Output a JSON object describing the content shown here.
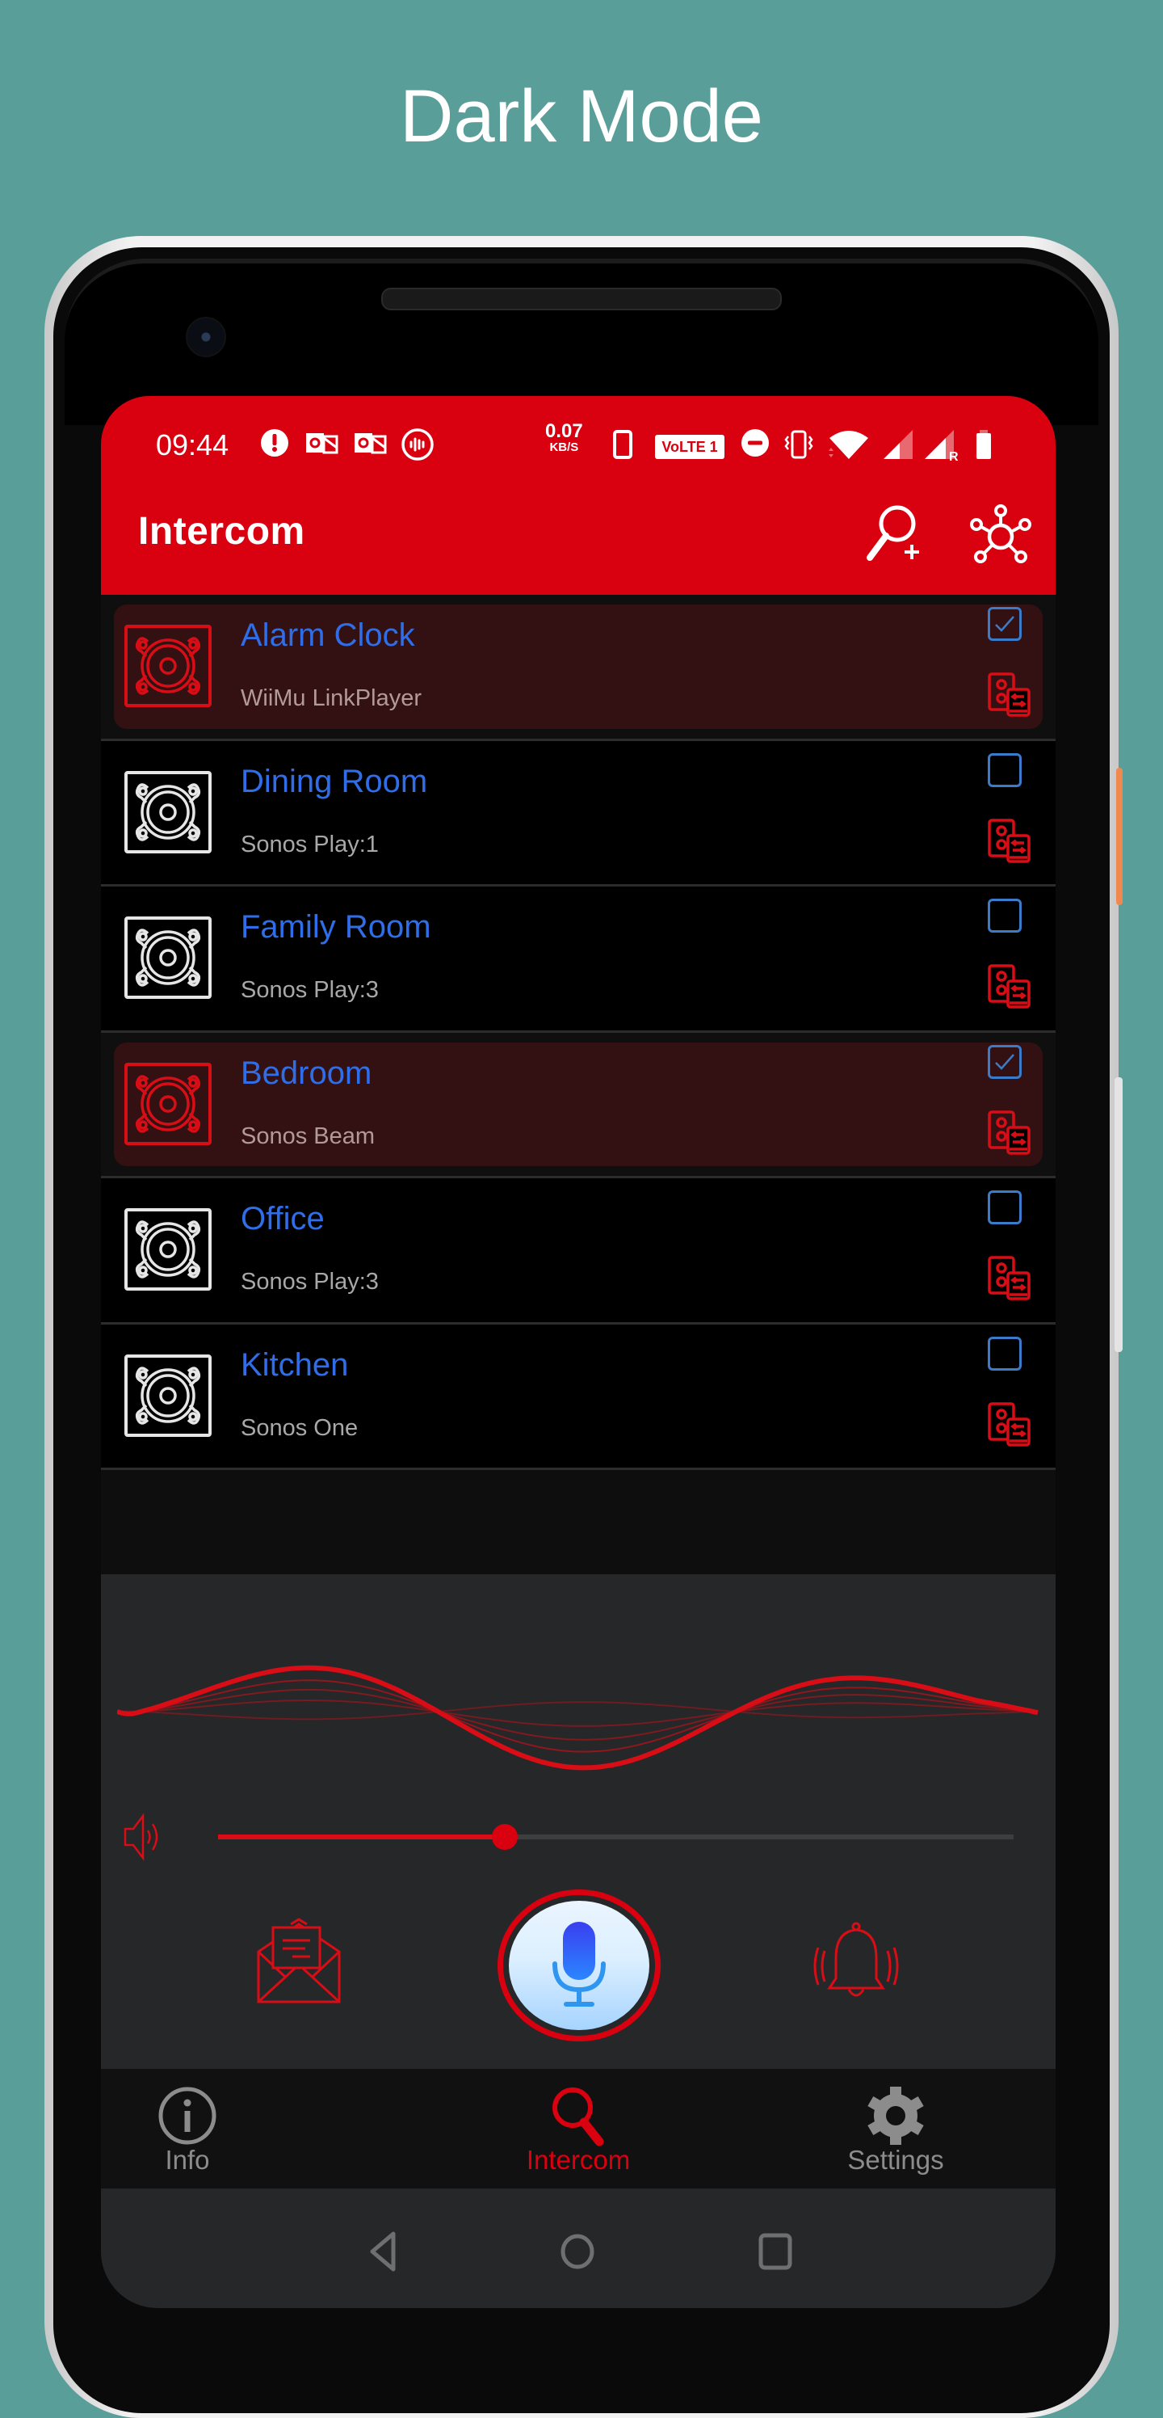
{
  "promo": {
    "title": "Dark Mode"
  },
  "status_bar": {
    "time": "09:44",
    "net_speed_value": "0.07",
    "net_speed_unit": "KB/S",
    "volte_label": "VoLTE 1",
    "left_icons": [
      "alert-icon",
      "outlook-icon",
      "outlook-icon",
      "voice-assistant-icon"
    ],
    "right_icons": [
      "phone-device-icon",
      "volte-icon",
      "dnd-icon",
      "vibrate-icon",
      "wifi-icon",
      "signal-icon",
      "signal-roaming-icon",
      "battery-icon"
    ]
  },
  "appbar": {
    "title": "Intercom",
    "actions": [
      {
        "name": "search-add-device-button",
        "icon": "search-plus-icon"
      },
      {
        "name": "network-button",
        "icon": "network-hub-icon"
      }
    ]
  },
  "devices": [
    {
      "name": "Alarm Clock",
      "model": "WiiMu LinkPlayer",
      "selected": true
    },
    {
      "name": "Dining Room",
      "model": "Sonos Play:1",
      "selected": false
    },
    {
      "name": "Family Room",
      "model": "Sonos Play:3",
      "selected": false
    },
    {
      "name": "Bedroom",
      "model": "Sonos Beam",
      "selected": true
    },
    {
      "name": "Office",
      "model": "Sonos Play:3",
      "selected": false
    },
    {
      "name": "Kitchen",
      "model": "Sonos One",
      "selected": false
    }
  ],
  "controls": {
    "volume_fraction": 0.36,
    "buttons": [
      "message-icon",
      "microphone-icon",
      "bell-icon"
    ]
  },
  "bottom_nav": {
    "items": [
      {
        "label": "Info",
        "icon": "info-icon",
        "active": false
      },
      {
        "label": "Intercom",
        "icon": "search-icon",
        "active": true
      },
      {
        "label": "Settings",
        "icon": "gear-icon",
        "active": false
      }
    ]
  },
  "system_nav": {
    "buttons": [
      "back-icon",
      "home-icon",
      "recents-icon"
    ]
  },
  "colors": {
    "accent_red": "#d9000f",
    "device_name_blue": "#2f6ee8",
    "checkbox_blue": "#3a7cc9",
    "selected_row_bg": "#331112",
    "panel_bg": "#252729",
    "page_bg": "#5a9e99"
  }
}
